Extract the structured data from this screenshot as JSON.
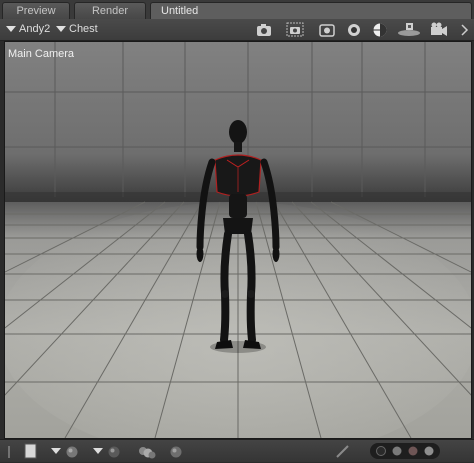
{
  "tabs": [
    {
      "label": "Preview"
    },
    {
      "label": "Render"
    },
    {
      "label": "Untitled"
    }
  ],
  "toolbar": {
    "figure_menu": "Andy2",
    "part_menu": "Chest",
    "icons": [
      "camera-icon",
      "camera-frame-icon",
      "camera-snapshot-icon",
      "circle-dot-icon",
      "sphere-icon",
      "ground-plane-icon",
      "movie-camera-icon",
      "chevron-right-icon"
    ]
  },
  "viewport": {
    "camera_label": "Main Camera"
  },
  "bottombar": {
    "icons": [
      "document-icon",
      "sphere-dropdown-icon",
      "shaded-sphere-dropdown-icon",
      "multi-sphere-icon",
      "sphere-small-icon",
      "pencil-icon",
      "color-swatches"
    ]
  },
  "colors": {
    "background_color_1": "#2a2a2a",
    "background_color_2": "#7a7a7a",
    "background_color_3": "#6e5555",
    "background_color_4": "#8e8e8e"
  }
}
